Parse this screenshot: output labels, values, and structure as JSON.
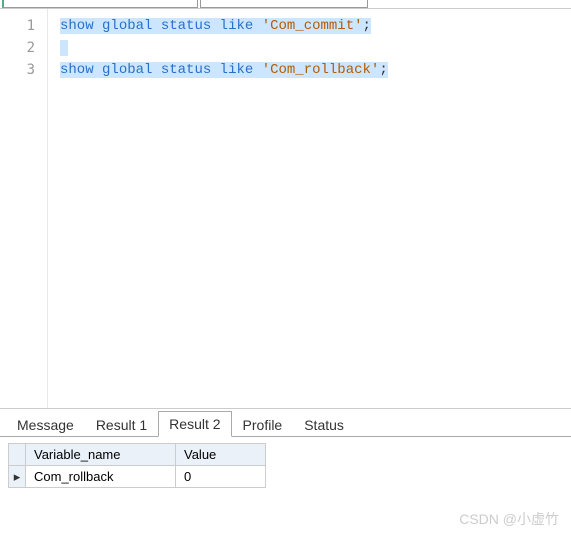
{
  "editor": {
    "lines": [
      {
        "n": "1",
        "tokens": [
          {
            "t": "show",
            "c": "kw"
          },
          {
            "t": " ",
            "c": ""
          },
          {
            "t": "global",
            "c": "kw"
          },
          {
            "t": " ",
            "c": ""
          },
          {
            "t": "status",
            "c": "kw"
          },
          {
            "t": " ",
            "c": ""
          },
          {
            "t": "like",
            "c": "kw"
          },
          {
            "t": " ",
            "c": ""
          },
          {
            "t": "'Com_commit'",
            "c": "str"
          },
          {
            "t": ";",
            "c": "punct"
          }
        ],
        "selected": true
      },
      {
        "n": "2",
        "tokens": [],
        "selected": true
      },
      {
        "n": "3",
        "tokens": [
          {
            "t": "show",
            "c": "kw"
          },
          {
            "t": " ",
            "c": ""
          },
          {
            "t": "global",
            "c": "kw"
          },
          {
            "t": " ",
            "c": ""
          },
          {
            "t": "status",
            "c": "kw"
          },
          {
            "t": " ",
            "c": ""
          },
          {
            "t": "like",
            "c": "kw"
          },
          {
            "t": " ",
            "c": ""
          },
          {
            "t": "'Com_rollback'",
            "c": "str"
          },
          {
            "t": ";",
            "c": "punct"
          }
        ],
        "selected": true
      }
    ]
  },
  "tabs": {
    "items": [
      {
        "label": "Message",
        "active": false
      },
      {
        "label": "Result 1",
        "active": false
      },
      {
        "label": "Result 2",
        "active": true
      },
      {
        "label": "Profile",
        "active": false
      },
      {
        "label": "Status",
        "active": false
      }
    ]
  },
  "result": {
    "columns": [
      "Variable_name",
      "Value"
    ],
    "rows": [
      {
        "Variable_name": "Com_rollback",
        "Value": "0"
      }
    ]
  },
  "watermark": "CSDN @小虚竹"
}
